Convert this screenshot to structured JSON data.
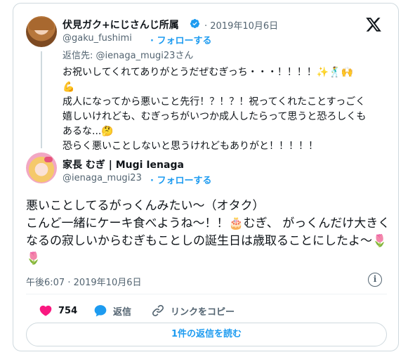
{
  "colors": {
    "accent": "#1d9bf0",
    "like": "#f91880",
    "secondary_text": "#536471",
    "border": "#cfd9de"
  },
  "parent_tweet": {
    "author_name": "伏見ガク+にじさんじ所属",
    "date": "· 2019年10月6日",
    "handle": "@gaku_fushimi",
    "follow_label": "· フォローする",
    "reply_to": "返信先: @ienaga_mugi23さん",
    "text": "お祝いしてくれてありがとうだぜむぎっち・・・！！！！✨🕺🙌\n💪\n成人になってから悪いこと先行！？！？！祝ってくれたことすっごく嬉しいけれども、むぎっちがいつか成人したらって思うと恐ろしくもあるな...🤔\n恐らく悪いことしないと思うけれどもありがと！！！！！"
  },
  "main_tweet": {
    "author_name": "家長 むぎ | Mugi Ienaga",
    "handle": "@ienaga_mugi23",
    "follow_label": "· フォローする",
    "text": "悪いことしてるがっくんみたい〜（オタク）\nこんど一緒にケーキ食べようね〜！！🎂むぎ、 がっくんだけ大きくなるの寂しいからむぎもことしの誕生日は歳取ることにしたよ〜🌷🌷",
    "timestamp": "午後6:07 · 2019年10月6日",
    "info_icon_label": "i"
  },
  "actions": {
    "like_count": "754",
    "reply_label": "返信",
    "copy_link_label": "リンクをコピー"
  },
  "read_replies_label": "1件の返信を読む",
  "icons": [
    "verified-badge-icon",
    "x-logo-icon",
    "heart-icon",
    "reply-bubble-icon",
    "link-icon",
    "info-icon"
  ]
}
